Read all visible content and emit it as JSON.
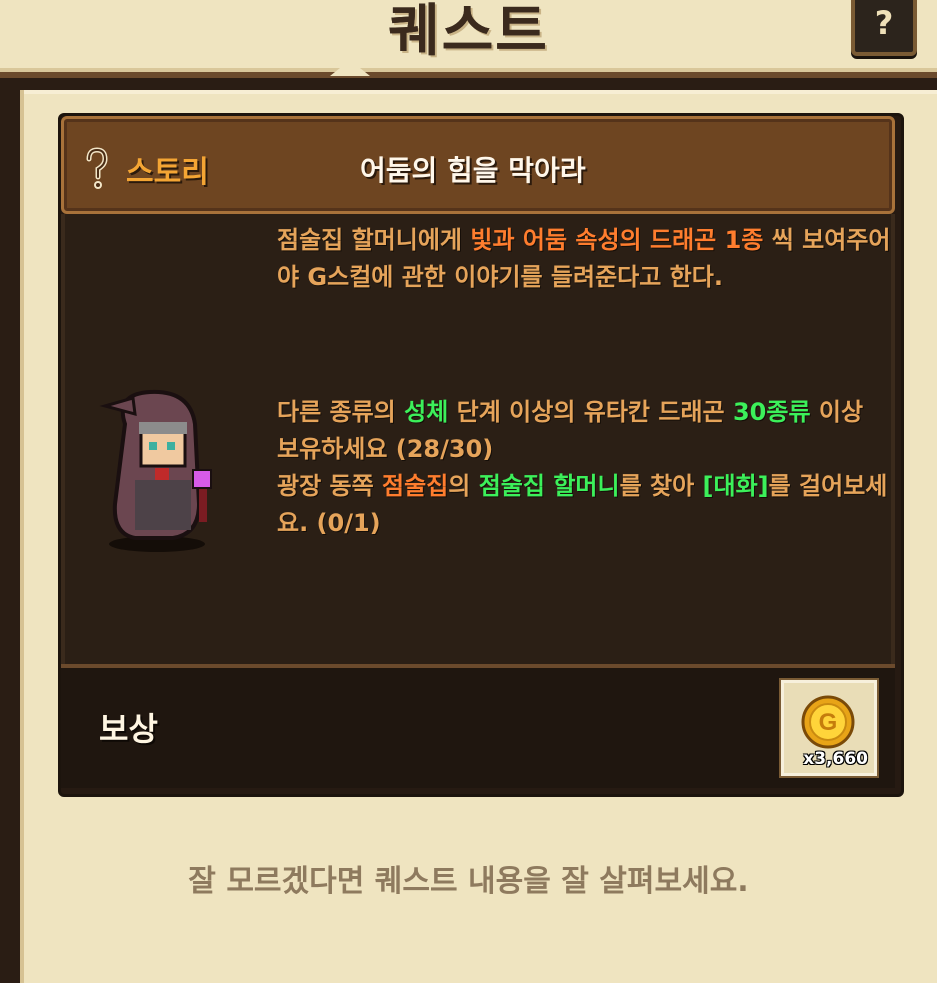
{
  "header": {
    "title": "퀘스트",
    "help_label": "?"
  },
  "quest": {
    "category": "스토리",
    "title": "어둠의 힘을 막아라",
    "description": {
      "part1": "점술집 할머니에게 ",
      "highlight": "빛과 어둠 속성의 드래곤 1종",
      "part2": " 씩 보여주어야 G스컬에 관한 이야기를 들려준다고 한다."
    },
    "objectives": {
      "o1_a": "다른 종류의 ",
      "o1_b": "성체",
      "o1_c": " 단계 이상의 유타칸 드래곤 ",
      "o1_d": "30종류",
      "o1_e": " 이상 보유하세요 (28/30)",
      "o2_a": "광장 동쪽 ",
      "o2_b": "점술집",
      "o2_c": "의 ",
      "o2_d": "점술집 할머니",
      "o2_e": "를 찾아 ",
      "o2_f": "[대화]",
      "o2_g": "를 걸어보세요. (0/1)"
    },
    "reward_label": "보상",
    "reward_item": {
      "icon": "gold-coin-icon",
      "quantity": "x3,660"
    }
  },
  "footer": {
    "hint": "잘 모르겠다면 퀘스트 내용을 잘 살펴보세요."
  },
  "colors": {
    "highlight_orange": "#ff7d2e",
    "highlight_green": "#3cf05a",
    "text_default": "#e6a45a",
    "category": "#f4a534"
  }
}
